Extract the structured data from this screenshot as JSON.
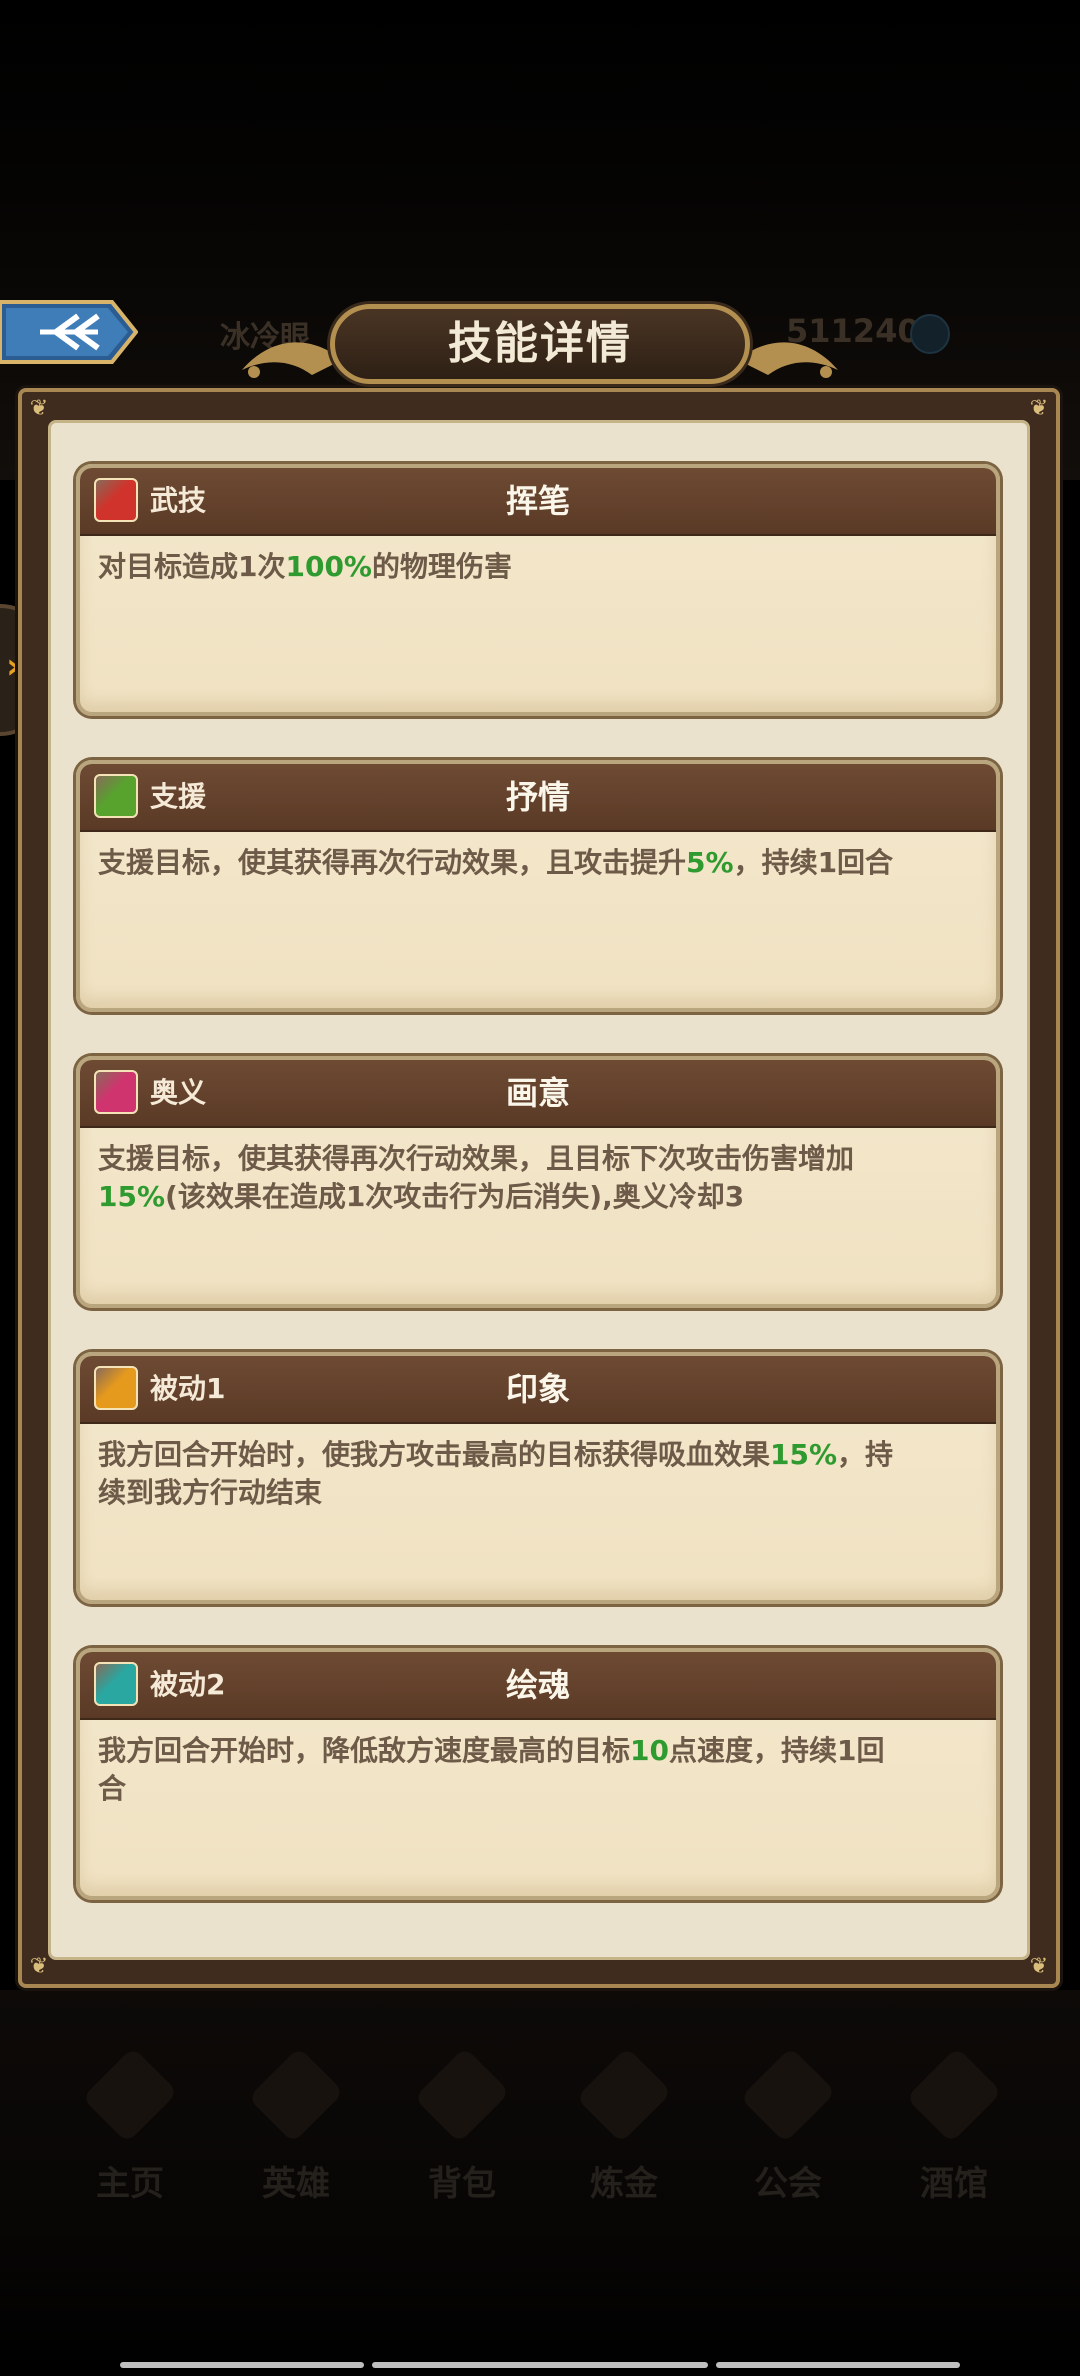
{
  "dialog": {
    "title": "技能详情"
  },
  "background": {
    "faded_name": "冰冷眼",
    "faded_number": "511240"
  },
  "side_tab": {
    "glyph": "›"
  },
  "skills": [
    {
      "type": "武技",
      "name": "挥笔",
      "icon": "sword-icon",
      "icon_color": "#d0332b",
      "desc_parts": [
        "对目标造成1次",
        "100%",
        "的物理伤害"
      ]
    },
    {
      "type": "支援",
      "name": "抒情",
      "icon": "support-icon",
      "icon_color": "#58a32e",
      "desc_parts": [
        "支援目标，使其获得再次行动效果，且攻击提升",
        "5%",
        "，持续1回合"
      ]
    },
    {
      "type": "奥义",
      "name": "画意",
      "icon": "ultimate-icon",
      "icon_color": "#d0346e",
      "desc_parts": [
        "支援目标，使其获得再次行动效果，且目标下次攻击伤害增加",
        "15%",
        "(该效果在造成1次攻击行为后消失),奥义冷却3"
      ]
    },
    {
      "type": "被动1",
      "name": "印象",
      "icon": "passive-person-icon",
      "icon_color": "#e69a1d",
      "desc_parts": [
        "我方回合开始时，使我方攻击最高的目标获得吸血效果",
        "15%",
        "，持续到我方行动结束"
      ]
    },
    {
      "type": "被动2",
      "name": "绘魂",
      "icon": "passive-spirit-icon",
      "icon_color": "#2aa7a1",
      "desc_parts": [
        "我方回合开始时，降低敌方速度最高的目标",
        "10",
        "点速度，持续1回合"
      ]
    }
  ],
  "bottom_nav": [
    "主页",
    "英雄",
    "背包",
    "炼金",
    "公会",
    "酒馆"
  ],
  "colors": {
    "highlight_green": "#2f9a2f",
    "card_header": "#6e4a33",
    "frame_gold": "#a88752"
  }
}
